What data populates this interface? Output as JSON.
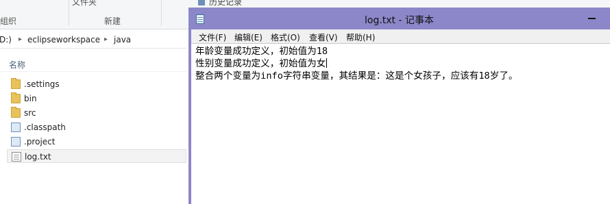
{
  "explorer": {
    "ribbon": {
      "group_left_label": "组织",
      "top_center_label": "文件夹",
      "group_center_label": "新建",
      "history_label": "历史记录"
    },
    "address": {
      "drive": "D:)",
      "segments": [
        "eclipseworkspace",
        "java"
      ]
    },
    "column_header": "名称",
    "items": [
      {
        "name": ".settings",
        "icon": "folder-icon"
      },
      {
        "name": "bin",
        "icon": "folder-icon"
      },
      {
        "name": "src",
        "icon": "folder-icon"
      },
      {
        "name": ".classpath",
        "icon": "document-icon"
      },
      {
        "name": ".project",
        "icon": "document-icon"
      },
      {
        "name": "log.txt",
        "icon": "text-file-icon",
        "selected": true
      }
    ]
  },
  "notepad": {
    "title": "log.txt - 记事本",
    "colors": {
      "titlebar": "#8c87c9"
    },
    "menu": [
      "文件(F)",
      "编辑(E)",
      "格式(O)",
      "查看(V)",
      "帮助(H)"
    ],
    "lines": [
      "年龄变量成功定义，初始值为18",
      "性别变量成功定义，初始值为女",
      "整合两个变量为info字符串变量，其结果是：这是个女孩子，应该有18岁了。"
    ]
  }
}
